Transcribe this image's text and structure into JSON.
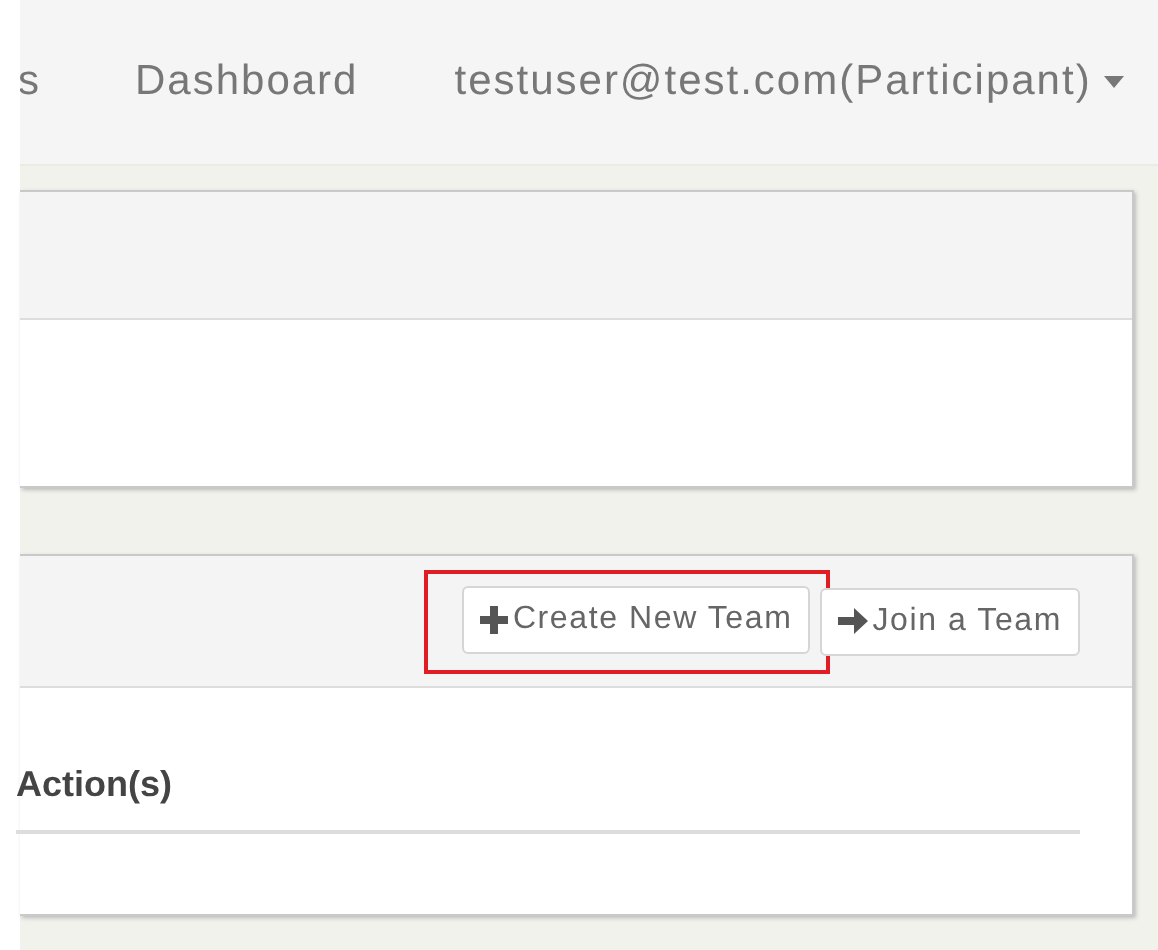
{
  "navbar": {
    "items": [
      {
        "label": "s"
      },
      {
        "label": "Dashboard"
      }
    ],
    "user_menu": {
      "label": "testuser@test.com(Participant)"
    }
  },
  "panels": [
    {
      "kind": "empty"
    },
    {
      "kind": "teams",
      "buttons": [
        {
          "label": "Create New Team",
          "kind": "plus",
          "highlighted": true
        },
        {
          "label": "Join a Team",
          "kind": "arrow",
          "highlighted": false
        }
      ],
      "columns": [
        "Action(s)"
      ]
    }
  ]
}
